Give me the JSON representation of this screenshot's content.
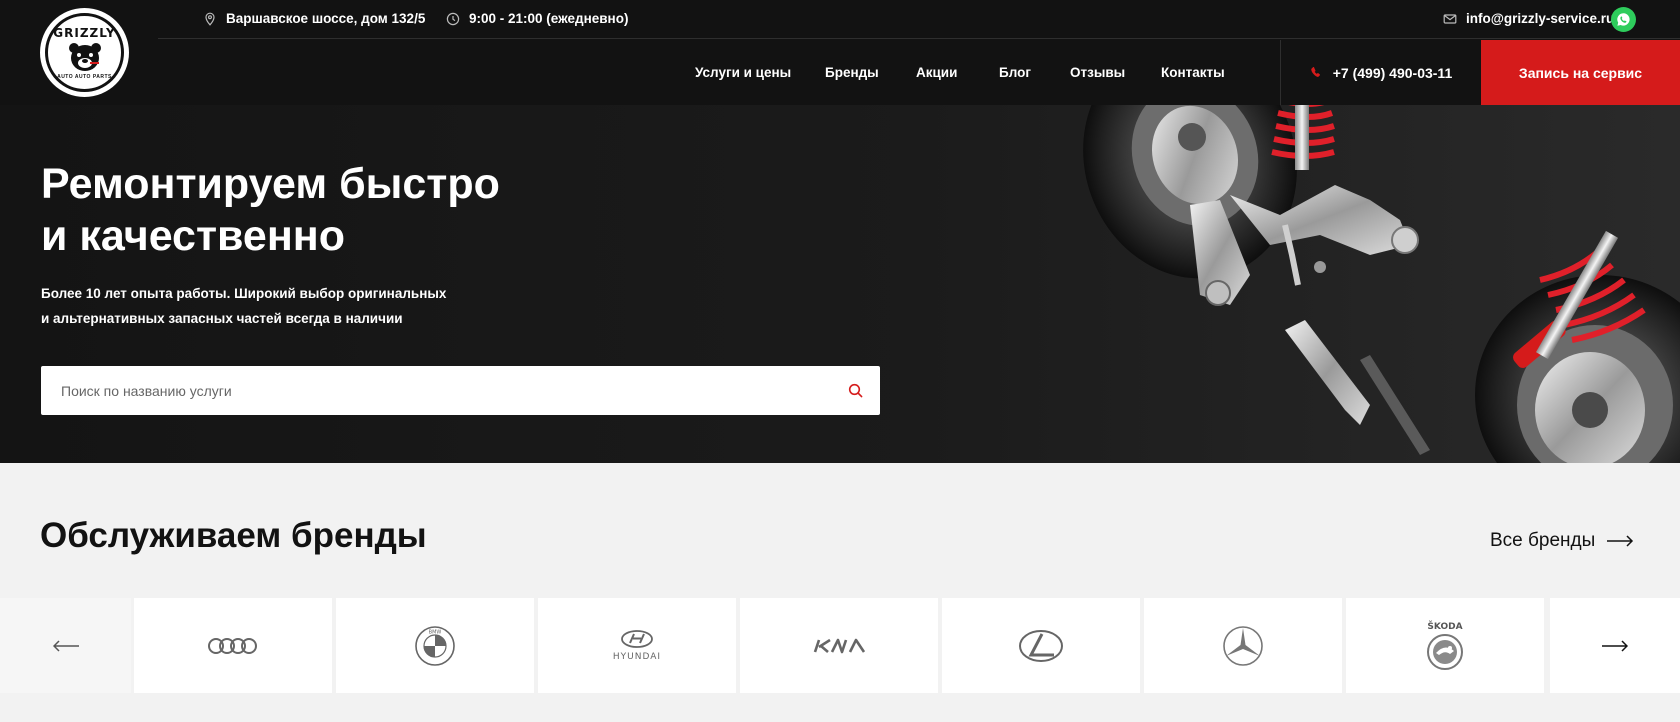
{
  "header": {
    "logo": {
      "text": "GRIZZLY",
      "sub": "AUTO AUTO PARTS"
    },
    "address": "Варшавское шоссе, дом 132/5",
    "hours": "9:00 - 21:00 (ежедневно)",
    "email": "info@grizzly-service.ru",
    "nav": [
      "Услуги и цены",
      "Бренды",
      "Акции",
      "Блог",
      "Отзывы",
      "Контакты"
    ],
    "phone": "+7 (499) 490-03-11",
    "cta": "Запись на сервис"
  },
  "hero": {
    "title": "Ремонтируем быстро\nи качественно",
    "subtitle": "Более 10 лет опыта работы. Широкий выбор оригинальных\n и альтернативных запасных частей всегда в наличии",
    "search_placeholder": "Поиск по названию услуги"
  },
  "brands": {
    "title": "Обслуживаем бренды",
    "all_label": "Все бренды",
    "items": [
      {
        "name": "audi-logo"
      },
      {
        "name": "bmw-logo"
      },
      {
        "name": "hyundai-logo",
        "caption": "HYUNDAI"
      },
      {
        "name": "kia-logo",
        "caption": "KIA"
      },
      {
        "name": "lexus-logo"
      },
      {
        "name": "mercedes-logo"
      },
      {
        "name": "skoda-logo",
        "caption": "ŠKODA"
      }
    ]
  },
  "colors": {
    "accent": "#d51b1b",
    "dark": "#121212",
    "whatsapp": "#2ecc5c"
  }
}
